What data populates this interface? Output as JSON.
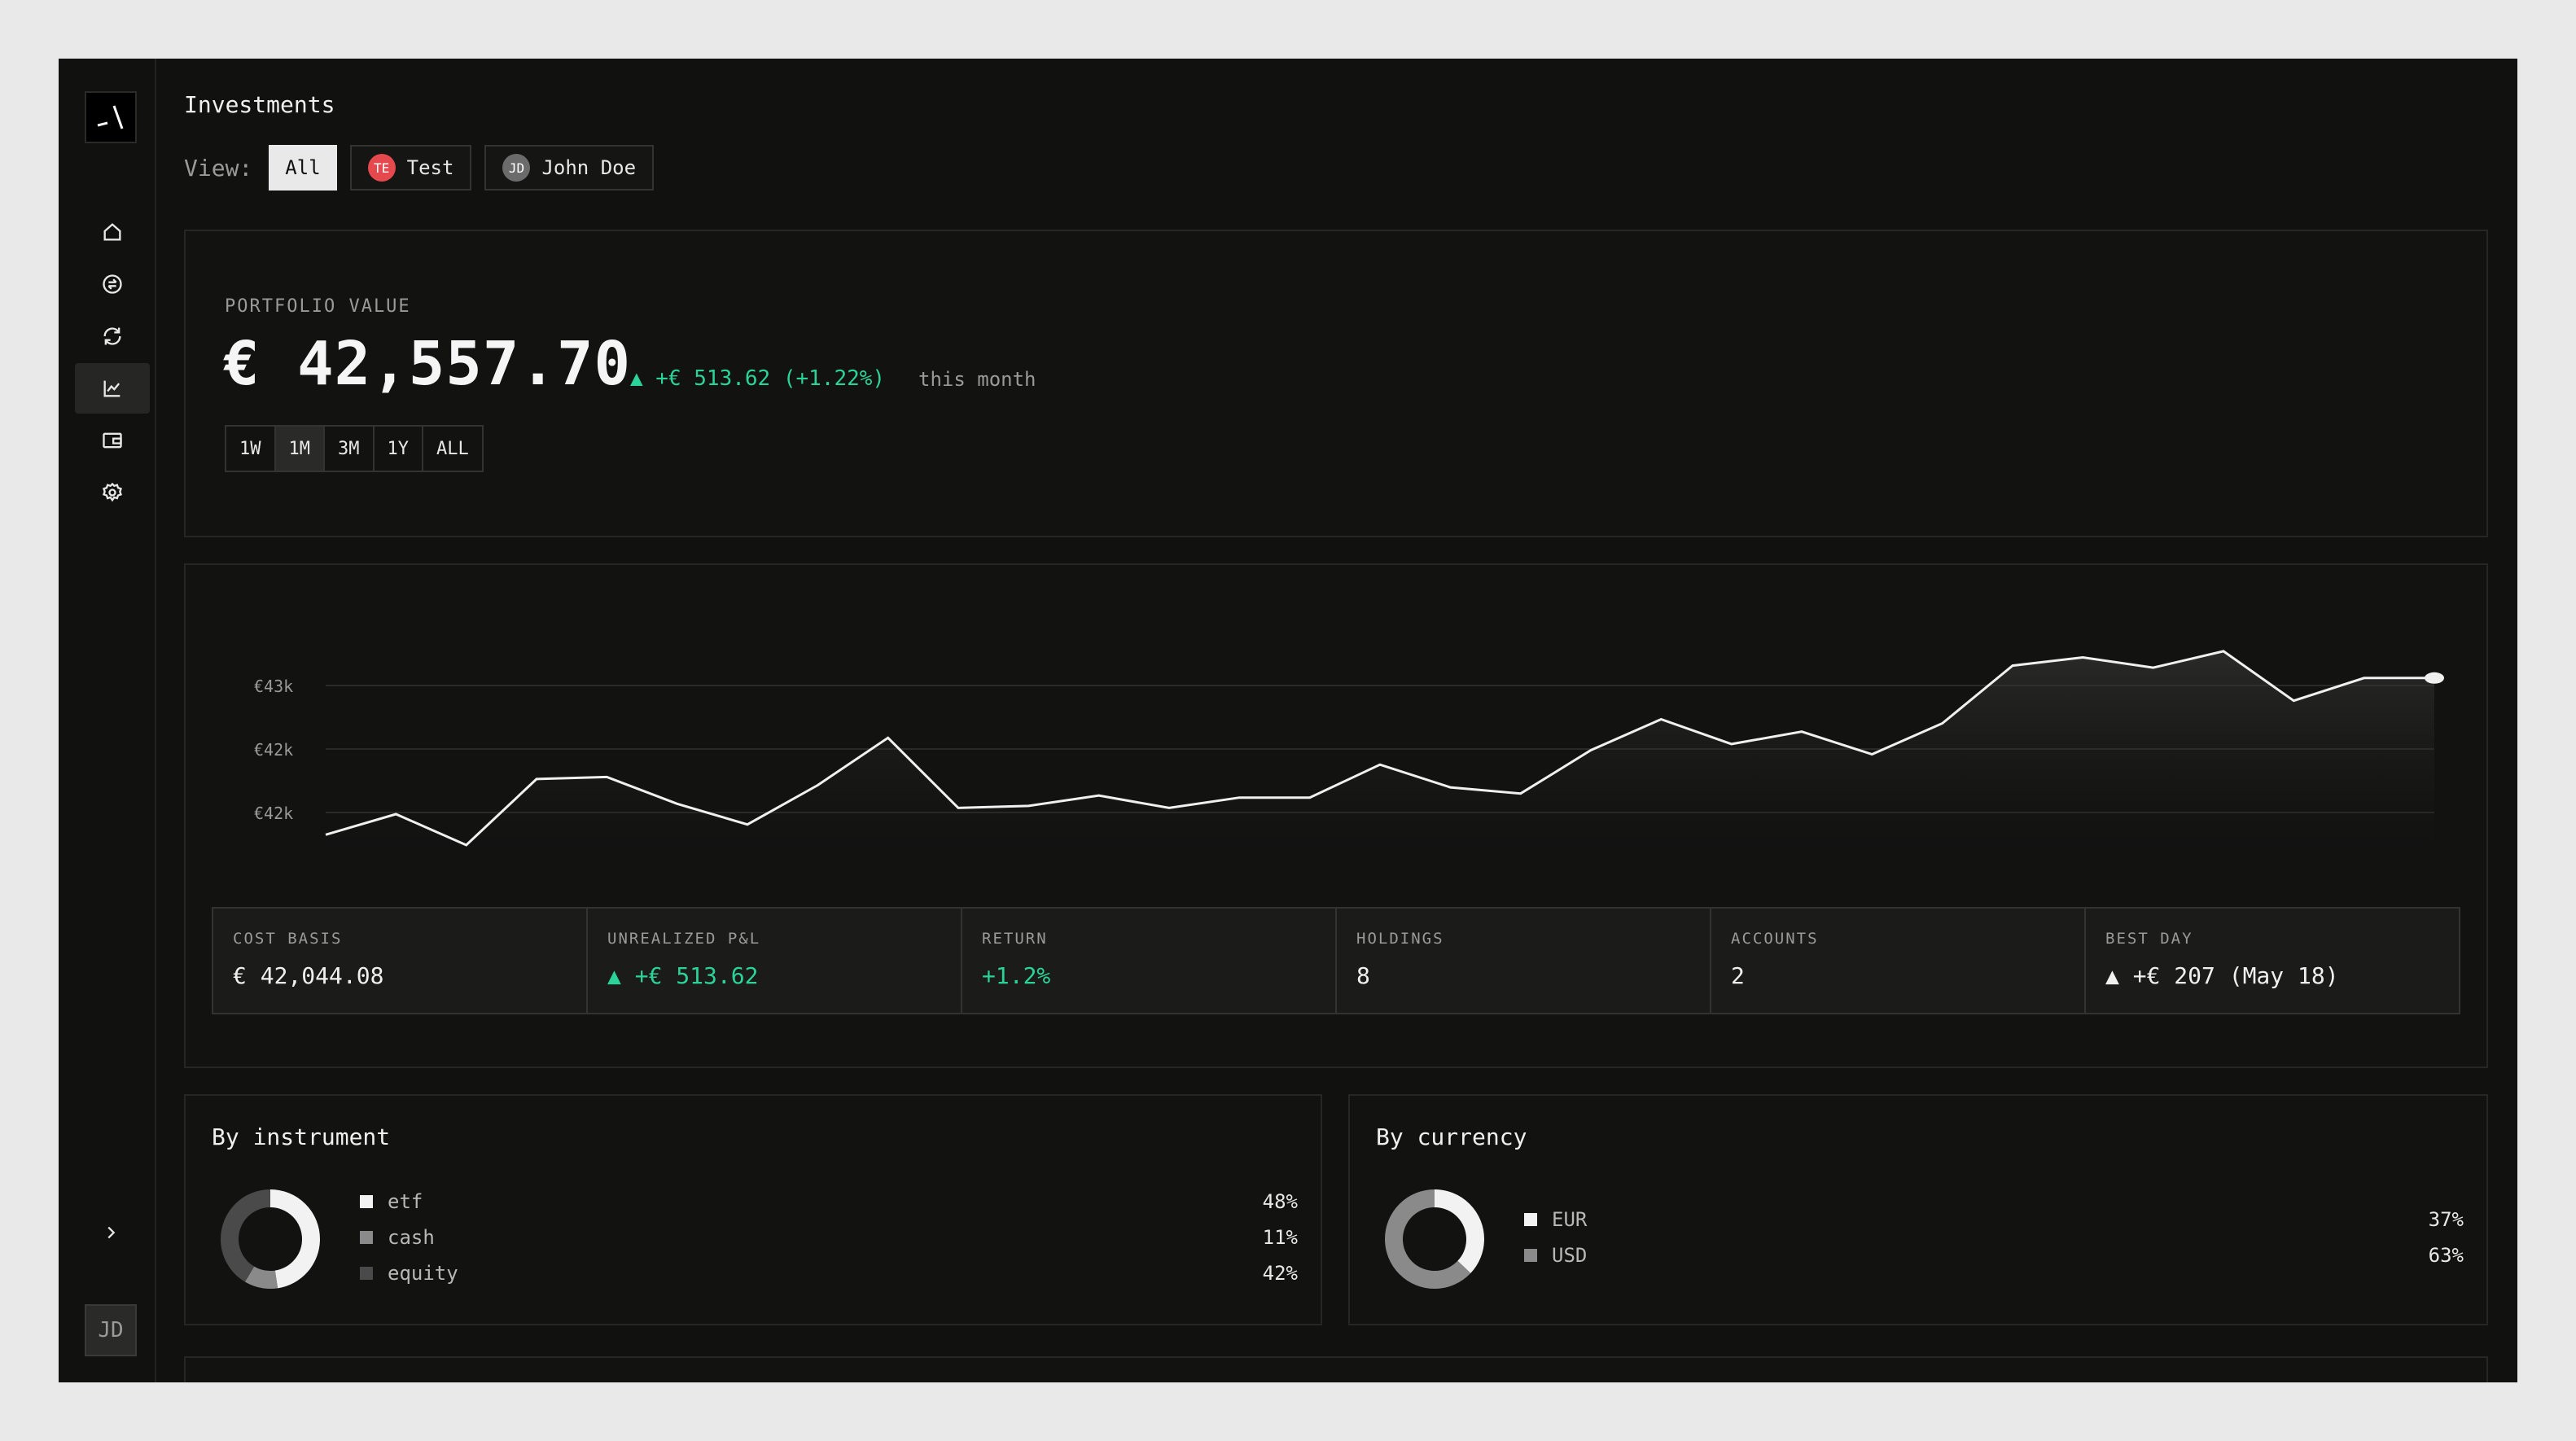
{
  "app": {
    "logo_icon": "slash-logo-icon",
    "user_initials": "JD"
  },
  "sidebar": {
    "items": [
      {
        "name": "home",
        "icon": "home-icon",
        "active": false
      },
      {
        "name": "transactions",
        "icon": "exchange-icon",
        "active": false
      },
      {
        "name": "recurring",
        "icon": "refresh-icon",
        "active": false
      },
      {
        "name": "investments",
        "icon": "chart-line-icon",
        "active": true
      },
      {
        "name": "wallet",
        "icon": "wallet-icon",
        "active": false
      },
      {
        "name": "settings",
        "icon": "gear-icon",
        "active": false
      }
    ],
    "expand_icon": "chevron-right-icon"
  },
  "header": {
    "title": "Investments",
    "view_label": "View:",
    "views": [
      {
        "label": "All",
        "active": true
      },
      {
        "label": "Test",
        "initials": "TE",
        "color": "#e5484d",
        "active": false
      },
      {
        "label": "John Doe",
        "initials": "JD",
        "color": "#6b6b6b",
        "active": false
      }
    ]
  },
  "portfolio": {
    "label": "PORTFOLIO VALUE",
    "value": "€ 42,557.70",
    "change": "▲ +€ 513.62 (+1.22%)",
    "period": "this month",
    "ranges": [
      {
        "label": "1W",
        "active": false
      },
      {
        "label": "1M",
        "active": true
      },
      {
        "label": "3M",
        "active": false
      },
      {
        "label": "1Y",
        "active": false
      },
      {
        "label": "ALL",
        "active": false
      }
    ]
  },
  "chart_data": {
    "type": "area",
    "yticks": [
      "€43k",
      "€42k",
      "€42k"
    ],
    "values": [
      41550,
      41650,
      41500,
      41820,
      41830,
      41700,
      41600,
      41790,
      42020,
      41680,
      41690,
      41740,
      41680,
      41730,
      41730,
      41890,
      41780,
      41750,
      41960,
      42110,
      41990,
      42050,
      41940,
      42090,
      42370,
      42410,
      42360,
      42440,
      42200,
      42310,
      42310
    ],
    "ylim": [
      41200,
      42700
    ],
    "line_color": "#f0f0f0",
    "grid": true
  },
  "stats": [
    {
      "label": "COST BASIS",
      "value": "€ 42,044.08",
      "tone": "normal"
    },
    {
      "label": "UNREALIZED P&L",
      "value": "▲ +€ 513.62",
      "tone": "green"
    },
    {
      "label": "RETURN",
      "value": "+1.2%",
      "tone": "green"
    },
    {
      "label": "HOLDINGS",
      "value": "8",
      "tone": "normal"
    },
    {
      "label": "ACCOUNTS",
      "value": "2",
      "tone": "normal"
    },
    {
      "label": "BEST DAY",
      "value": "▲ +€ 207 (May 18)",
      "tone": "normal"
    }
  ],
  "by_instrument": {
    "title": "By instrument",
    "items": [
      {
        "label": "etf",
        "pct": "48%",
        "value": 48,
        "color": "#f2f2f2"
      },
      {
        "label": "cash",
        "pct": "11%",
        "value": 11,
        "color": "#8a8a8a"
      },
      {
        "label": "equity",
        "pct": "42%",
        "value": 42,
        "color": "#4a4a4a"
      }
    ]
  },
  "by_currency": {
    "title": "By currency",
    "items": [
      {
        "label": "EUR",
        "pct": "37%",
        "value": 37,
        "color": "#f2f2f2"
      },
      {
        "label": "USD",
        "pct": "63%",
        "value": 63,
        "color": "#8a8a8a"
      }
    ]
  }
}
